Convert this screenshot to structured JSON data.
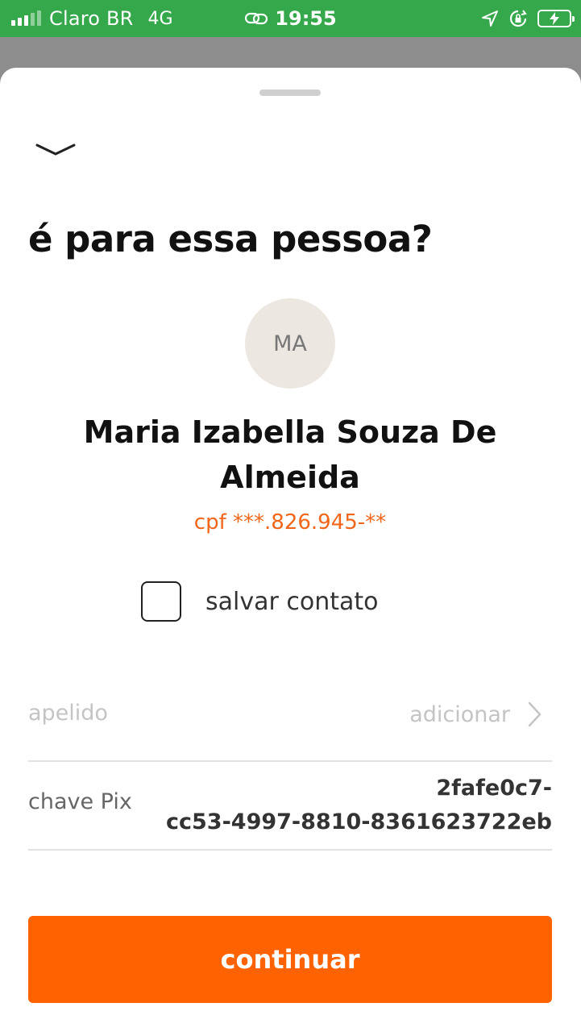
{
  "status_bar": {
    "carrier": "Claro BR",
    "network": "4G",
    "time": "19:55",
    "icons": [
      "signal-icon",
      "link-icon",
      "location-arrow-icon",
      "rotation-lock-icon",
      "battery-charging-icon"
    ]
  },
  "sheet": {
    "title": "é para essa pessoa?",
    "avatar_initials": "MA",
    "recipient_name": "Maria Izabella Souza De Almeida",
    "cpf": "cpf ***.826.945-**",
    "save_contact_label": "salvar contato",
    "save_contact_checked": false,
    "nickname": {
      "label": "apelido",
      "action": "adicionar"
    },
    "pix_key": {
      "label": "chave Pix",
      "value": "2fafe0c7-\ncc53-4997-8810-8361623722eb"
    },
    "continue_label": "continuar"
  },
  "colors": {
    "status_bar": "#34a84a",
    "accent": "#ff6200",
    "cpf_text": "#f2661a",
    "avatar_bg": "#ece7e1"
  }
}
